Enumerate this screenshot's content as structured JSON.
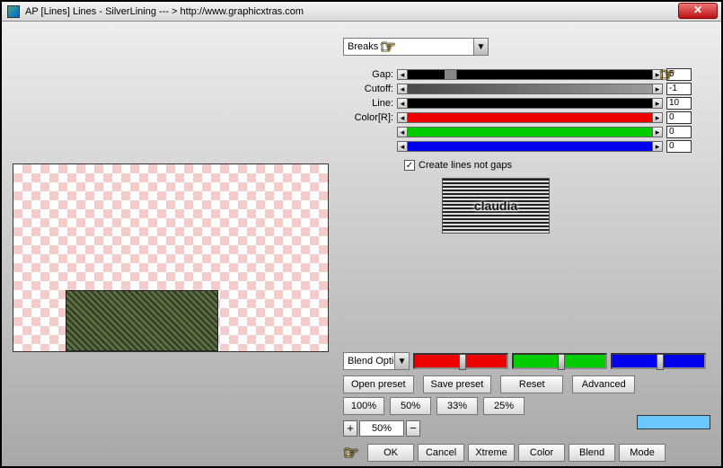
{
  "title": "AP [Lines]  Lines - SilverLining    --- >  http://www.graphicxtras.com",
  "dropdown_mode": "Breaks",
  "sliders": [
    {
      "label": "Gap:",
      "track_bg": "linear-gradient(90deg,#000 0 15%,#888 15% 20%,#000 20% 100%)",
      "value": "5"
    },
    {
      "label": "Cutoff:",
      "track_bg": "linear-gradient(90deg,#4a4a4a,#9a9a9a)",
      "value": "-1"
    },
    {
      "label": "Line:",
      "track_bg": "#000",
      "value": "10"
    },
    {
      "label": "Color[R]:",
      "track_bg": "#e00",
      "value": "0"
    },
    {
      "label": "",
      "track_bg": "#0c0",
      "value": "0"
    },
    {
      "label": "",
      "track_bg": "#00e",
      "value": "0"
    }
  ],
  "checkbox": {
    "label": "Create lines not gaps",
    "checked": true
  },
  "logo_text": "claudia",
  "blend_dd": "Blend Optic",
  "color_sliders": [
    {
      "bg": "#e00"
    },
    {
      "bg": "#0c0"
    },
    {
      "bg": "#00e"
    }
  ],
  "preset_buttons": [
    "Open preset",
    "Save preset",
    "Reset",
    "Advanced"
  ],
  "zoom_presets": [
    "100%",
    "50%",
    "33%",
    "25%"
  ],
  "zoom_value": "50%",
  "swatch_color": "#6cc7ff",
  "action_buttons": [
    "OK",
    "Cancel",
    "Xtreme",
    "Color",
    "Blend",
    "Mode"
  ]
}
